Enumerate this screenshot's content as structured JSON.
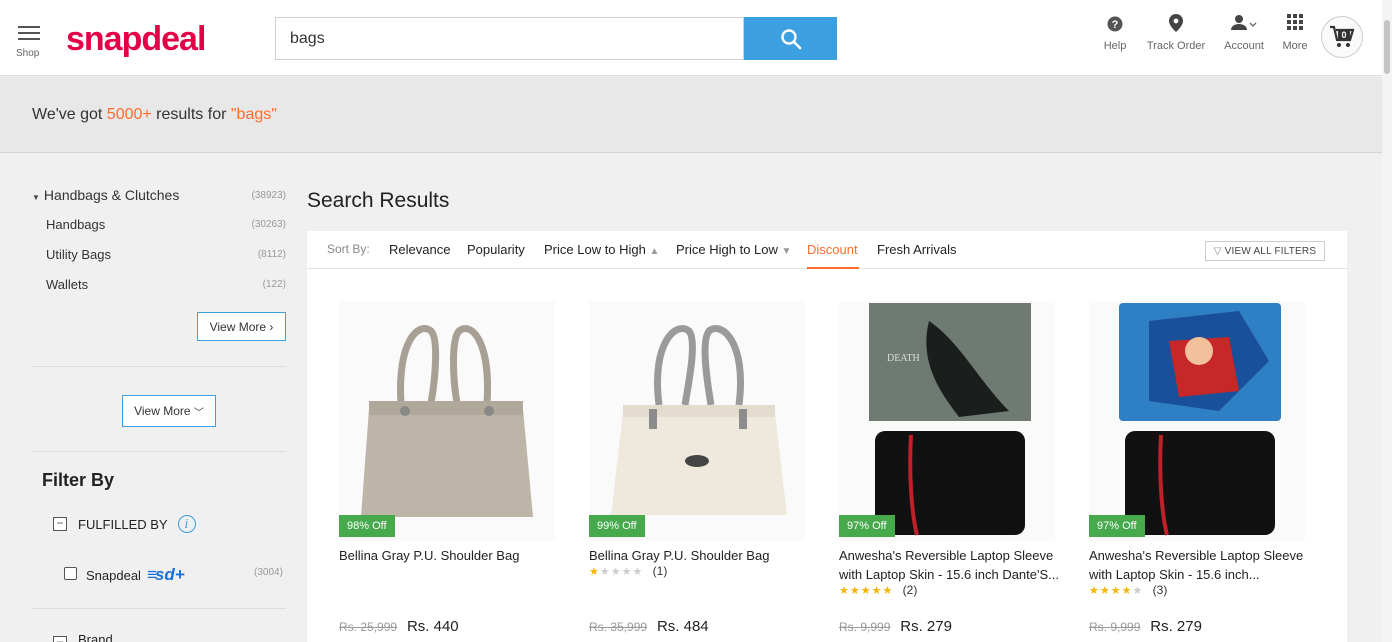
{
  "header": {
    "shop_label": "Shop",
    "logo": "snapdeal",
    "search_value": "bags",
    "help": "Help",
    "track_order": "Track Order",
    "account": "Account",
    "more": "More",
    "cart_count": "0"
  },
  "results": {
    "prefix": "We've got ",
    "count": "5000+",
    "middle": " results for ",
    "query": "\"bags\""
  },
  "sidebar": {
    "main_category": {
      "label": "Handbags & Clutches",
      "count": "(38923)"
    },
    "categories": [
      {
        "label": "Handbags",
        "count": "(30263)"
      },
      {
        "label": "Utility Bags",
        "count": "(8112)"
      },
      {
        "label": "Wallets",
        "count": "(122)"
      }
    ],
    "view_more_1": "View More",
    "view_more_2": "View More",
    "filter_by": "Filter By",
    "fulfilled_by": "FULFILLED BY",
    "snapdeal_option": "Snapdeal",
    "sd_plus": "sd+",
    "snapdeal_count": "(3004)",
    "brand": "Brand"
  },
  "main": {
    "title": "Search Results",
    "sort_label": "Sort By:",
    "sort_options": [
      "Relevance",
      "Popularity",
      "Price Low to High",
      "Price High to Low",
      "Discount",
      "Fresh Arrivals"
    ],
    "active_sort": "Discount",
    "view_all_filters": "VIEW ALL FILTERS"
  },
  "products": [
    {
      "discount": "98% Off",
      "name": "Bellina Gray P.U. Shoulder Bag",
      "rating": 0,
      "reviews": "",
      "old_price": "Rs. 25,999",
      "price": "Rs. 440"
    },
    {
      "discount": "99% Off",
      "name": "Bellina Gray P.U. Shoulder Bag",
      "rating": 1,
      "reviews": "(1)",
      "old_price": "Rs. 35,999",
      "price": "Rs. 484"
    },
    {
      "discount": "97% Off",
      "name": "Anwesha's Reversible Laptop Sleeve with Laptop Skin - 15.6 inch Dante'S...",
      "rating": 5,
      "reviews": "(2)",
      "old_price": "Rs. 9,999",
      "price": "Rs. 279"
    },
    {
      "discount": "97% Off",
      "name": "Anwesha's Reversible Laptop Sleeve with Laptop Skin - 15.6 inch...",
      "rating": 4,
      "reviews": "(3)",
      "old_price": "Rs. 9,999",
      "price": "Rs. 279"
    }
  ],
  "colors": {
    "brand": "#e40046",
    "accent": "#3c9fe0",
    "highlight": "#ff6d2d",
    "discount_badge": "#46a94c"
  }
}
